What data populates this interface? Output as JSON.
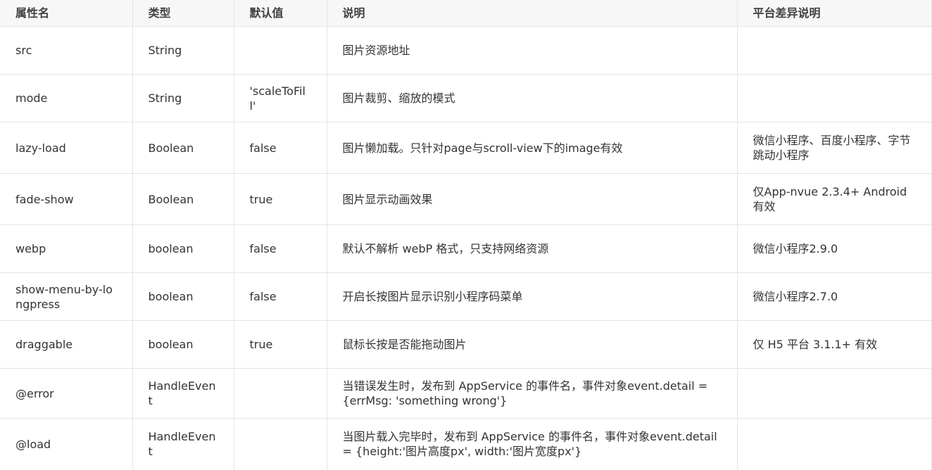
{
  "table": {
    "headers": [
      "属性名",
      "类型",
      "默认值",
      "说明",
      "平台差异说明"
    ],
    "rows": [
      {
        "name": "src",
        "type": "String",
        "default": "",
        "desc": "图片资源地址",
        "platform": ""
      },
      {
        "name": "mode",
        "type": "String",
        "default": "'scaleToFill'",
        "desc": "图片裁剪、缩放的模式",
        "platform": ""
      },
      {
        "name": "lazy-load",
        "type": "Boolean",
        "default": "false",
        "desc": "图片懒加载。只针对page与scroll-view下的image有效",
        "platform": "微信小程序、百度小程序、字节跳动小程序"
      },
      {
        "name": "fade-show",
        "type": "Boolean",
        "default": "true",
        "desc": "图片显示动画效果",
        "platform": "仅App-nvue 2.3.4+ Android有效"
      },
      {
        "name": "webp",
        "type": "boolean",
        "default": "false",
        "desc": "默认不解析 webP 格式，只支持网络资源",
        "platform": "微信小程序2.9.0"
      },
      {
        "name": "show-menu-by-longpress",
        "type": "boolean",
        "default": "false",
        "desc": "开启长按图片显示识别小程序码菜单",
        "platform": "微信小程序2.7.0"
      },
      {
        "name": "draggable",
        "type": "boolean",
        "default": "true",
        "desc": "鼠标长按是否能拖动图片",
        "platform": "仅 H5 平台 3.1.1+ 有效"
      },
      {
        "name": "@error",
        "type": "HandleEvent",
        "default": "",
        "desc": "当错误发生时，发布到 AppService 的事件名，事件对象event.detail = {errMsg: 'something wrong'}",
        "platform": ""
      },
      {
        "name": "@load",
        "type": "HandleEvent",
        "default": "",
        "desc": "当图片载入完毕时，发布到 AppService 的事件名，事件对象event.detail = {height:'图片高度px', width:'图片宽度px'}",
        "platform": ""
      }
    ]
  }
}
